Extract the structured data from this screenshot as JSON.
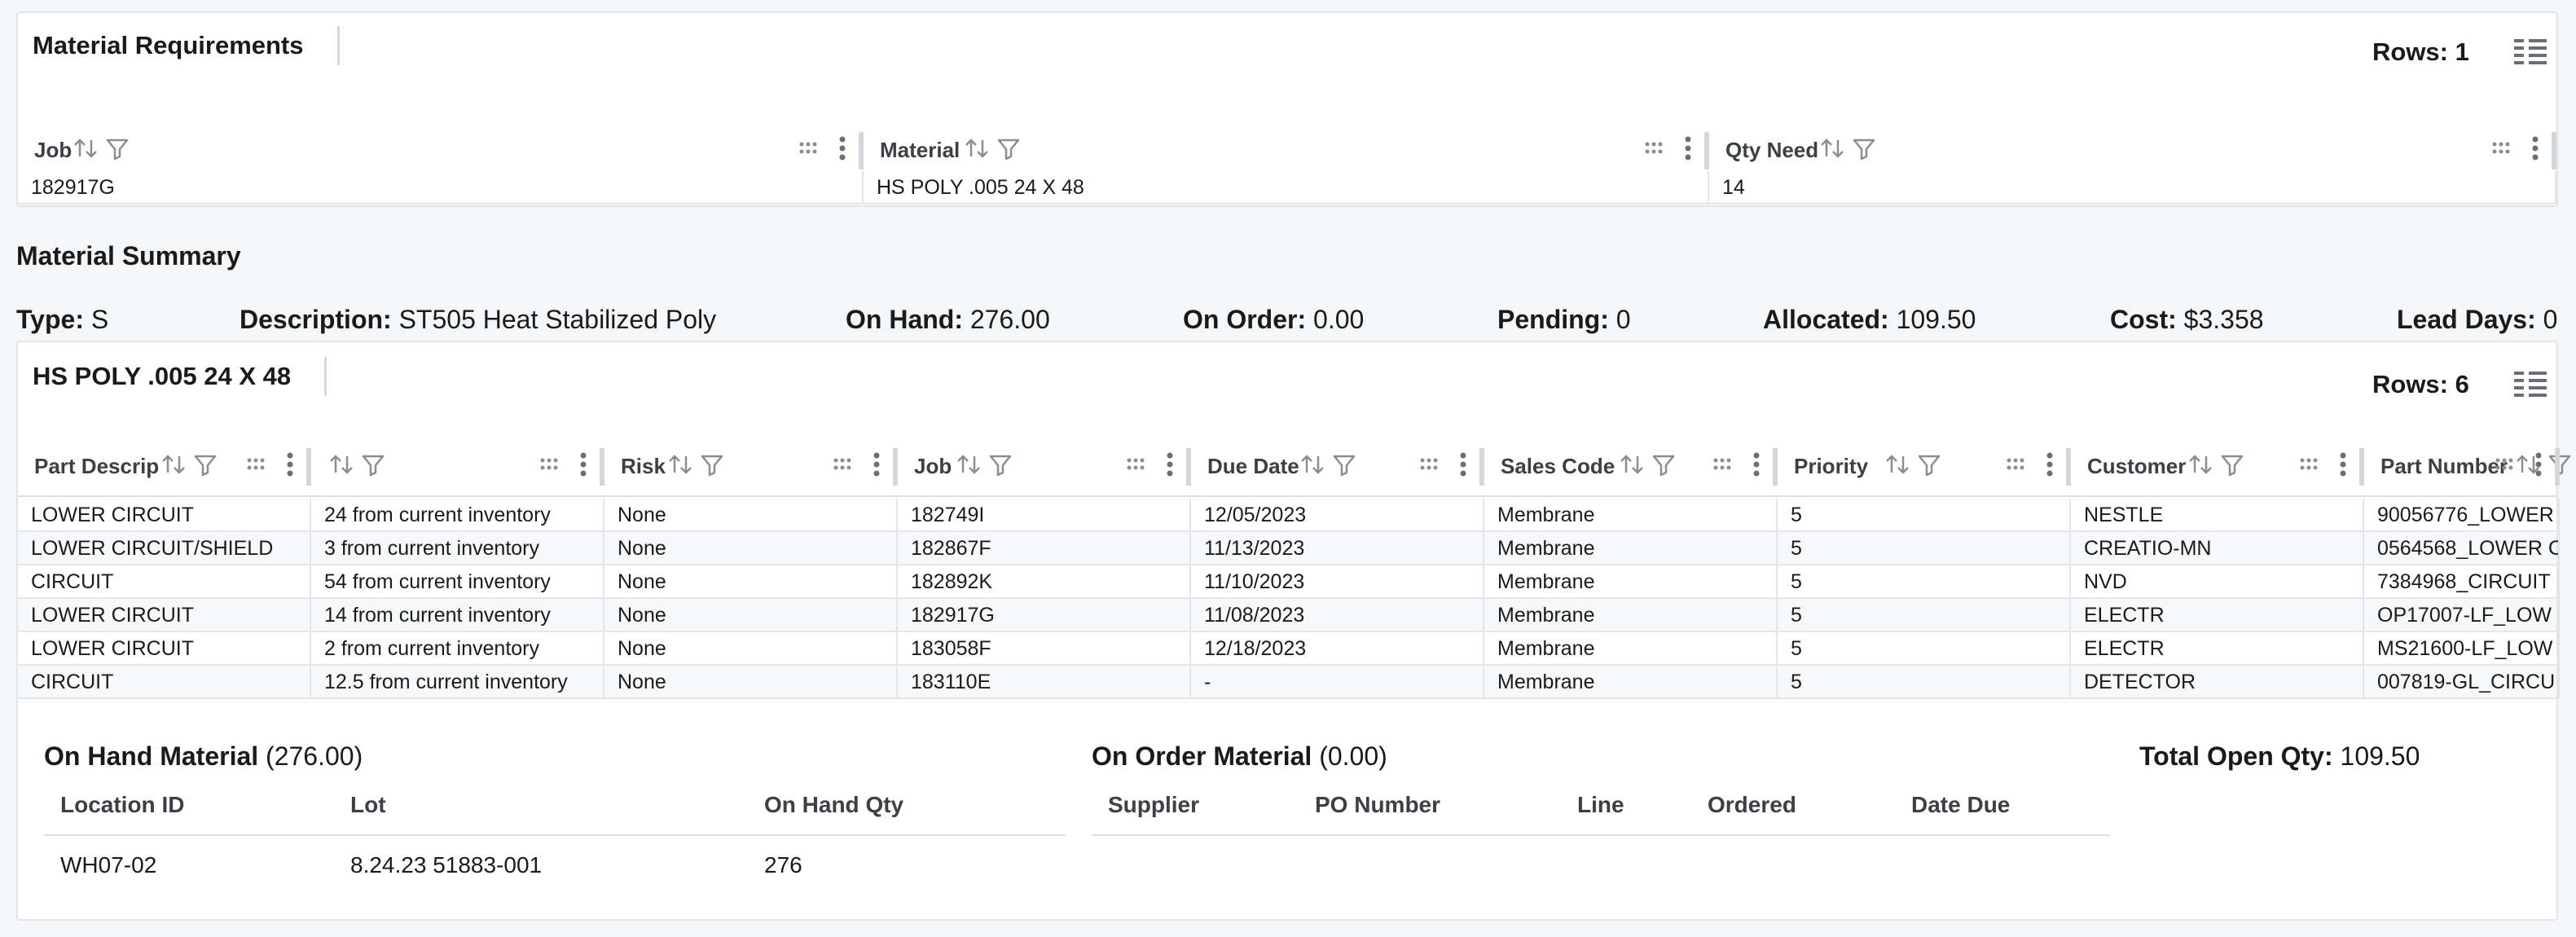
{
  "req_panel": {
    "title": "Material Requirements",
    "rows_label": "Rows: 1",
    "columns": [
      {
        "label": "Job"
      },
      {
        "label": "Material"
      },
      {
        "label": "Qty Need"
      }
    ],
    "rows": [
      [
        "182917G",
        "HS POLY .005 24 X 48",
        "14"
      ]
    ]
  },
  "summary": {
    "title": "Material Summary",
    "items": [
      {
        "label": "Type:",
        "value": "S"
      },
      {
        "label": "Description:",
        "value": "ST505 Heat Stabilized Poly"
      },
      {
        "label": "On Hand:",
        "value": "276.00"
      },
      {
        "label": "On Order:",
        "value": "0.00"
      },
      {
        "label": "Pending:",
        "value": "0"
      },
      {
        "label": "Allocated:",
        "value": "109.50"
      },
      {
        "label": "Cost:",
        "value": "$3.358"
      },
      {
        "label": "Lead Days:",
        "value": "0"
      }
    ]
  },
  "usage_panel": {
    "title": "HS POLY .005 24 X 48",
    "rows_label": "Rows: 6",
    "columns": [
      {
        "label": "Part Descrip"
      },
      {
        "label": ""
      },
      {
        "label": "Risk"
      },
      {
        "label": "Job"
      },
      {
        "label": "Due Date"
      },
      {
        "label": "Sales Code"
      },
      {
        "label": "Priority"
      },
      {
        "label": "Customer"
      },
      {
        "label": "Part Number"
      }
    ],
    "rows": [
      [
        "LOWER CIRCUIT",
        "24 from current inventory",
        "None",
        "182749I",
        "12/05/2023",
        "Membrane",
        "5",
        "NESTLE",
        "90056776_LOWER"
      ],
      [
        "LOWER CIRCUIT/SHIELD",
        "3 from current inventory",
        "None",
        "182867F",
        "11/13/2023",
        "Membrane",
        "5",
        "CREATIO-MN",
        "0564568_LOWER C"
      ],
      [
        "CIRCUIT",
        "54 from current inventory",
        "None",
        "182892K",
        "11/10/2023",
        "Membrane",
        "5",
        "NVD",
        "7384968_CIRCUIT"
      ],
      [
        "LOWER CIRCUIT",
        "14 from current inventory",
        "None",
        "182917G",
        "11/08/2023",
        "Membrane",
        "5",
        "ELECTR",
        "OP17007-LF_LOW"
      ],
      [
        "LOWER CIRCUIT",
        "2 from current inventory",
        "None",
        "183058F",
        "12/18/2023",
        "Membrane",
        "5",
        "ELECTR",
        "MS21600-LF_LOW"
      ],
      [
        "CIRCUIT",
        "12.5 from current inventory",
        "None",
        "183110E",
        "-",
        "Membrane",
        "5",
        "DETECTOR",
        "007819-GL_CIRCU"
      ]
    ]
  },
  "on_hand": {
    "title": "On Hand Material",
    "amount": "(276.00)",
    "headers": [
      "Location ID",
      "Lot",
      "On Hand Qty"
    ],
    "rows": [
      [
        "WH07-02",
        "8.24.23 51883-001",
        "276"
      ]
    ]
  },
  "on_order": {
    "title": "On Order Material",
    "amount": "(0.00)",
    "headers": [
      "Supplier",
      "PO Number",
      "Line",
      "Ordered",
      "Date Due"
    ]
  },
  "total_open": {
    "label": "Total Open Qty:",
    "value": "109.50"
  },
  "icons": {
    "sort": "sort-icon",
    "filter": "filter-icon",
    "grip": "drag-grip-icon",
    "menu": "column-menu-icon",
    "columns": "columns-chooser-icon"
  },
  "colors": {
    "header_text": "#3c3f44",
    "border": "#e3e5e8",
    "background": "#f5f6f8"
  }
}
